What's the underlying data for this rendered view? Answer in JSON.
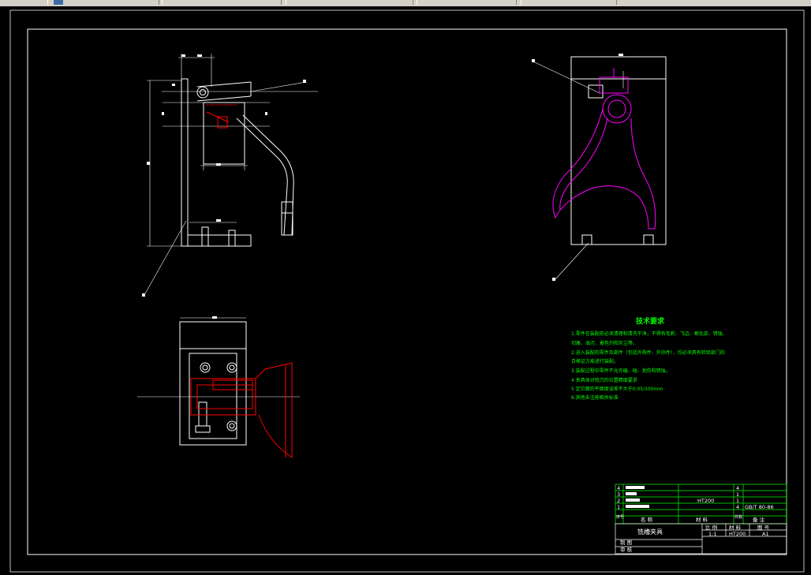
{
  "colors": {
    "background": "#000000",
    "outline": "#ffffff",
    "section": "#ff0000",
    "part": "#ff00ff",
    "notes": "#00ff00",
    "titleblock_lines": "#00ff00"
  },
  "tech_requirements": {
    "title": "技术要求",
    "lines": [
      "1.零件在装配前必须清理和清洗干净，不得有毛刺、飞边、氧化皮、锈蚀、",
      "切屑、油污、着色剂和灰尘等。",
      "2.进入装配的零件及部件（包括外购件、外协件），均必须具有检验部门的",
      "合格证方能进行装配。",
      "3.装配过程中零件不允许磕、碰、划伤和锈蚀。",
      "4  夹具体对铣刀的位置精度要求",
      "5  定位面的平面度误差不大于0.05/100mm",
      "6.其他未注按相关标准"
    ]
  },
  "title_block": {
    "rows": [
      {
        "seq": "4",
        "qty": "4"
      },
      {
        "seq": "3",
        "qty": "1"
      },
      {
        "seq": "2",
        "material": "HT200",
        "qty": "1"
      },
      {
        "seq": "1",
        "qty": "4",
        "note": "GB/T 80-86"
      }
    ],
    "header": {
      "seq": "序号",
      "name": "名  称",
      "material": "材  料",
      "qty": "件数",
      "note": "备  注"
    },
    "drawing_name": "铣槽夹具",
    "scale_label": "比 例",
    "material_label": "材 料",
    "sheet_label": "图 号",
    "scale_value": "1:1",
    "material_value": "HT200",
    "sheet_value": "A1",
    "drawn_by": "制 图",
    "checked_by": "审 核"
  }
}
